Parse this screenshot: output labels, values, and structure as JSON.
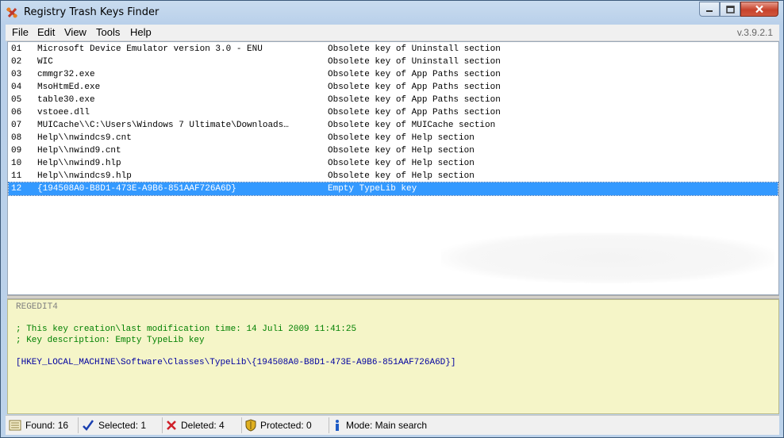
{
  "window": {
    "title": "Registry Trash Keys Finder"
  },
  "menu": {
    "items": [
      "File",
      "Edit",
      "View",
      "Tools",
      "Help"
    ],
    "version": "v.3.9.2.1"
  },
  "results": [
    {
      "num": "01",
      "key": "Microsoft Device Emulator version 3.0 - ENU",
      "desc": "Obsolete key of Uninstall section"
    },
    {
      "num": "02",
      "key": "WIC",
      "desc": "Obsolete key of Uninstall section"
    },
    {
      "num": "03",
      "key": "cmmgr32.exe",
      "desc": "Obsolete key of App Paths section"
    },
    {
      "num": "04",
      "key": "MsoHtmEd.exe",
      "desc": "Obsolete key of App Paths section"
    },
    {
      "num": "05",
      "key": "table30.exe",
      "desc": "Obsolete key of App Paths section"
    },
    {
      "num": "06",
      "key": "vstoee.dll",
      "desc": "Obsolete key of App Paths section"
    },
    {
      "num": "07",
      "key": "MUICache\\\\C:\\Users\\Windows 7 Ultimate\\Downloads…",
      "desc": "Obsolete key of MUICache section"
    },
    {
      "num": "08",
      "key": "Help\\\\nwindcs9.cnt",
      "desc": "Obsolete key of Help section"
    },
    {
      "num": "09",
      "key": "Help\\\\nwind9.cnt",
      "desc": "Obsolete key of Help section"
    },
    {
      "num": "10",
      "key": "Help\\\\nwind9.hlp",
      "desc": "Obsolete key of Help section"
    },
    {
      "num": "11",
      "key": "Help\\\\nwindcs9.hlp",
      "desc": "Obsolete key of Help section"
    },
    {
      "num": "12",
      "key": "{194508A0-B8D1-473E-A9B6-851AAF726A6D}",
      "desc": "Empty TypeLib key",
      "selected": true
    }
  ],
  "detail": {
    "header": "REGEDIT4",
    "comment1": "; This key creation\\last modification time: 14 Juli 2009 11:41:25",
    "comment2": "; Key description: Empty TypeLib key",
    "key_path": "[HKEY_LOCAL_MACHINE\\Software\\Classes\\TypeLib\\{194508A0-B8D1-473E-A9B6-851AAF726A6D}]",
    "header_color": "#808080",
    "comment_color": "#008000",
    "key_color": "#0000a0"
  },
  "status": {
    "found": "Found: 16",
    "selected": "Selected: 1",
    "deleted": "Deleted: 4",
    "protected": "Protected: 0",
    "mode": "Mode: Main search"
  },
  "colors": {
    "selection": "#3399ff",
    "detail_bg": "#f5f5c8"
  }
}
